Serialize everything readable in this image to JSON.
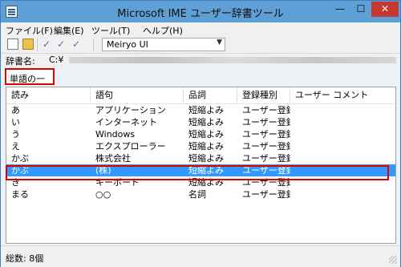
{
  "window": {
    "title": "Microsoft IME ユーザー辞書ツール",
    "min_glyph": "—",
    "max_glyph": "☐",
    "close_glyph": "✕"
  },
  "menu": [
    {
      "label": "ファイル(F)"
    },
    {
      "label": "編集(E)"
    },
    {
      "label": "ツール(T)"
    },
    {
      "label": "ヘルプ(H)"
    }
  ],
  "toolbar": {
    "icons": [
      "new-document-icon",
      "open-folder-icon",
      "check-icon",
      "check-icon",
      "check-icon"
    ],
    "font_value": "Meiryo UI",
    "dropdown_glyph": "▼"
  },
  "dictionary": {
    "label": "辞書名:",
    "path": "C:¥"
  },
  "section": {
    "title": "単語の一覧"
  },
  "table": {
    "columns": [
      "読み",
      "語句",
      "品詞",
      "登録種別",
      "ユーザー コメント"
    ],
    "rows": [
      [
        "あ",
        "アプリケーション",
        "短縮よみ",
        "ユーザー登録",
        ""
      ],
      [
        "い",
        "インターネット",
        "短縮よみ",
        "ユーザー登録",
        ""
      ],
      [
        "う",
        "Windows",
        "短縮よみ",
        "ユーザー登録",
        ""
      ],
      [
        "え",
        "エクスプローラー",
        "短縮よみ",
        "ユーザー登録",
        ""
      ],
      [
        "かぶ",
        "株式会社",
        "短縮よみ",
        "ユーザー登録",
        ""
      ],
      [
        "かぶ",
        "(株)",
        "短縮よみ",
        "ユーザー登録",
        ""
      ],
      [
        "き",
        "キーボード",
        "短縮よみ",
        "ユーザー登録",
        ""
      ],
      [
        "まる",
        "○○",
        "名詞",
        "ユーザー登録",
        ""
      ]
    ],
    "selected_index": 5
  },
  "status": {
    "text": "総数: 8個"
  },
  "colors": {
    "selection": "#3399ff",
    "highlight_border": "#e00000",
    "titlebar": "#5e9fd6"
  }
}
